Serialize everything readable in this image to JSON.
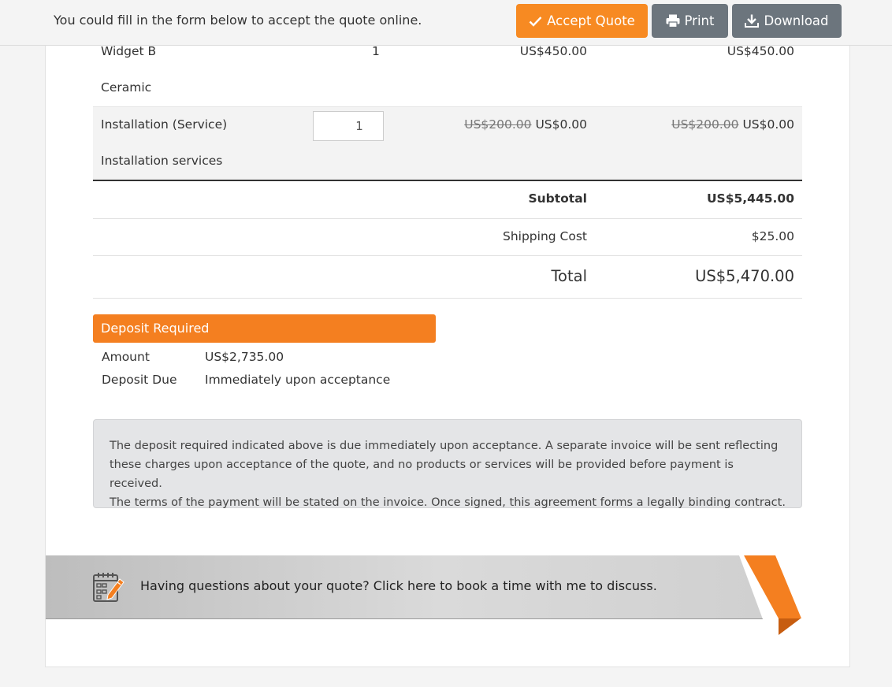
{
  "topbar": {
    "message": "You could fill in the form below to accept the quote online.",
    "accept_label": "Accept Quote",
    "print_label": "Print",
    "download_label": "Download"
  },
  "items": [
    {
      "name": "Widget B",
      "qty": "1",
      "unit_price": "US$450.00",
      "total": "US$450.00",
      "description": "Ceramic"
    },
    {
      "name": "Installation (Service)",
      "qty": "1",
      "unit_price_old": "US$200.00",
      "unit_price": "US$0.00",
      "total_old": "US$200.00",
      "total": "US$0.00",
      "description": "Installation services"
    }
  ],
  "totals": {
    "subtotal_label": "Subtotal",
    "subtotal": "US$5,445.00",
    "shipping_label": "Shipping Cost",
    "shipping": "$25.00",
    "total_label": "Total",
    "total": "US$5,470.00"
  },
  "deposit": {
    "heading": "Deposit Required",
    "amount_label": "Amount",
    "amount": "US$2,735.00",
    "due_label": "Deposit Due",
    "due": "Immediately upon acceptance"
  },
  "note": {
    "line1": "The deposit required indicated above is due immediately upon acceptance. A separate invoice will be sent reflecting",
    "line2": "these charges upon acceptance of the quote, and no products or services will be provided before payment is received.",
    "line3": "The terms of the payment will be stated on the invoice. Once signed, this agreement forms a legally binding contract."
  },
  "banner": {
    "text": "Having questions about your quote? Click here to book a time with me to discuss.",
    "icon": "calendar-edit-icon"
  },
  "colors": {
    "accent": "#f78a22",
    "button_gray": "#6c757d",
    "deposit_bar": "#f47f20"
  }
}
